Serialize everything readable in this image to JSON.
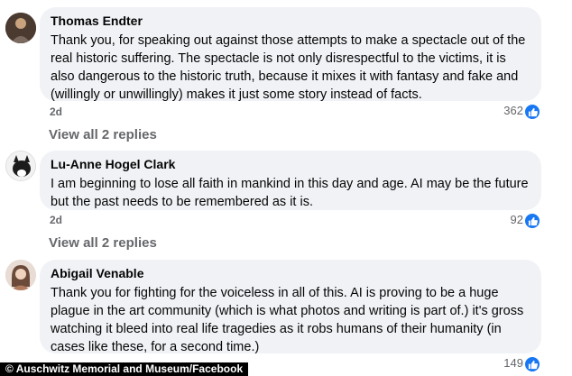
{
  "comments": [
    {
      "author": "Thomas Endter",
      "text": "Thank you, for speaking out against those attempts to make a spectacle out of the real historic suffering. The spectacle is not only disrespectful to the victims, it is also dangerous to the historic truth, because it mixes it with fantasy and fake and (willingly or unwillingly) makes it just some story instead of facts.",
      "time": "2d",
      "reactions": "362",
      "view_replies": "View all 2 replies"
    },
    {
      "author": "Lu-Anne Hogel Clark",
      "text": "I am beginning to lose all faith in mankind in this day and age. AI may be the future but the past needs to be remembered as it is.",
      "time": "2d",
      "reactions": "92",
      "view_replies": "View all 2 replies"
    },
    {
      "author": "Abigail Venable",
      "text": "Thank you for fighting for the voiceless in all of this. AI is proving to be a huge plague in the art community (which is what photos and writing is part of.) it's gross watching it bleed into real life tragedies as it robs humans of their humanity (in cases like these, for a second time.)",
      "time": "2d",
      "reactions": "149"
    }
  ],
  "credit": "Auschwitz Memorial and Museum/Facebook",
  "icons": {
    "reaction": "like-thumbs-up-icon"
  },
  "colors": {
    "like": "#1877f2",
    "bubble": "#f0f2f5",
    "meta": "#65676b"
  }
}
